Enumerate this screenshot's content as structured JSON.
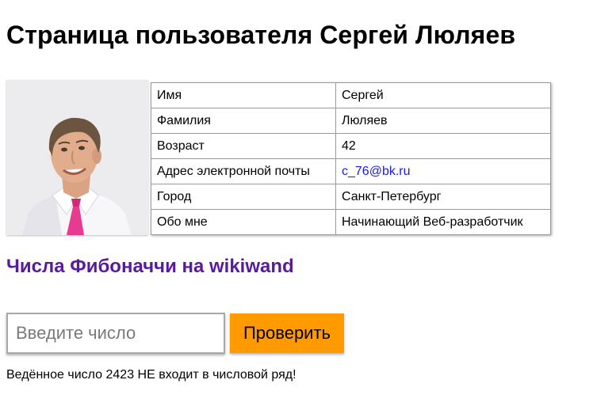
{
  "page": {
    "title": "Страница пользователя Сергей Люляев"
  },
  "profile": {
    "photo_icon": "user-photo",
    "rows": [
      {
        "label": "Имя",
        "value": "Сергей"
      },
      {
        "label": "Фамилия",
        "value": "Люляев"
      },
      {
        "label": "Возраст",
        "value": "42"
      },
      {
        "label": "Адрес электронной почты",
        "value": "c_76@bk.ru"
      },
      {
        "label": "Город",
        "value": "Санкт-Петербург"
      },
      {
        "label": "Обо мне",
        "value": "Начинающий Веб-разработчик"
      }
    ]
  },
  "fibonacci": {
    "link_text": "Числа Фибоначчи на wikiwand",
    "input_value": "",
    "input_placeholder": "Введите число",
    "button_label": "Проверить",
    "result_text": "Ведённое число 2423 НЕ входит в числовой ряд!"
  },
  "colors": {
    "button": "#ff9a00",
    "link_visited": "#5a1aa0",
    "email_link": "#1a1ae6"
  }
}
